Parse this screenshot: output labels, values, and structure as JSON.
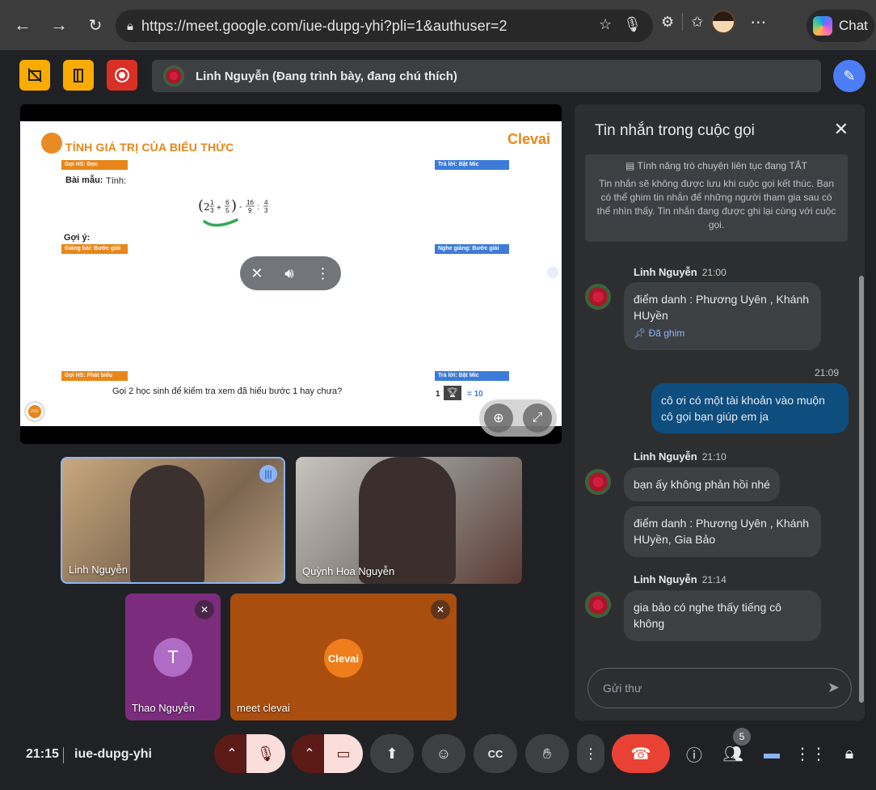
{
  "browser": {
    "url": "https://meet.google.com/iue-dupg-yhi?pli=1&authuser=2",
    "chat_label": "Chat"
  },
  "meet": {
    "presenting_text": "Linh Nguyễn (Đang trình bày, đang chú thích)",
    "slide": {
      "title": "TÍNH GIÁ TRỊ CỦA BIỂU THỨC",
      "brand": "Clevai",
      "tag1": "Gọi HS: Đọc",
      "tag2": "Trả lời: Bật Mic",
      "sample": "Bài mẫu:",
      "sample_tinh": "Tính:",
      "hint": "Gợi ý:",
      "tag3": "Giảng bài: Bước giải",
      "tag4": "Nghe giảng: Bước giải",
      "tag5": "Gọi HS: Phát biểu",
      "tag6": "Trả lời: Bật Mic",
      "question": "Gọi 2 học sinh để kiểm tra xem đã hiểu bước 1 hay chưa?",
      "score": "1",
      "score_eq": "= 10",
      "timer": "2:01"
    },
    "tiles": [
      {
        "name": "Linh Nguyễn"
      },
      {
        "name": "Quỳnh Hoa Nguyễn"
      },
      {
        "name": "Thao Nguyễn",
        "initial": "T"
      },
      {
        "name": "meet clevai",
        "logo": "Clevai"
      }
    ],
    "chat": {
      "title": "Tin nhắn trong cuộc gọi",
      "info_header": "Tính năng trò chuyện liên tục đang TẮT",
      "info_body": "Tin nhắn sẽ không được lưu khi cuộc gọi kết thúc. Bạn có thể ghim tin nhắn để những người tham gia sau có thể nhìn thấy. Tin nhắn đang được ghi lại cùng với cuộc gọi.",
      "messages": [
        {
          "sender": "Linh Nguyễn",
          "time": "21:00",
          "text": "điểm danh : Phương Uyên , Khánh HUyền",
          "pin": "Đã ghim"
        },
        {
          "time": "21:09",
          "text": "cô ơi có một tài khoản vào muộn cô gọi bạn giúp em ja"
        },
        {
          "sender": "Linh Nguyễn",
          "time": "21:10",
          "text": "bạn ấy không phản hồi nhé",
          "text2": "điểm danh : Phương Uyên , Khánh HUyền, Gia Bảo"
        },
        {
          "sender": "Linh Nguyễn",
          "time": "21:14",
          "text": "gia bảo có nghe thấy tiếng cô không"
        }
      ],
      "input_placeholder": "Gửi thư"
    },
    "bottom": {
      "time": "21:15",
      "code": "iue-dupg-yhi",
      "participants_count": "5"
    }
  }
}
